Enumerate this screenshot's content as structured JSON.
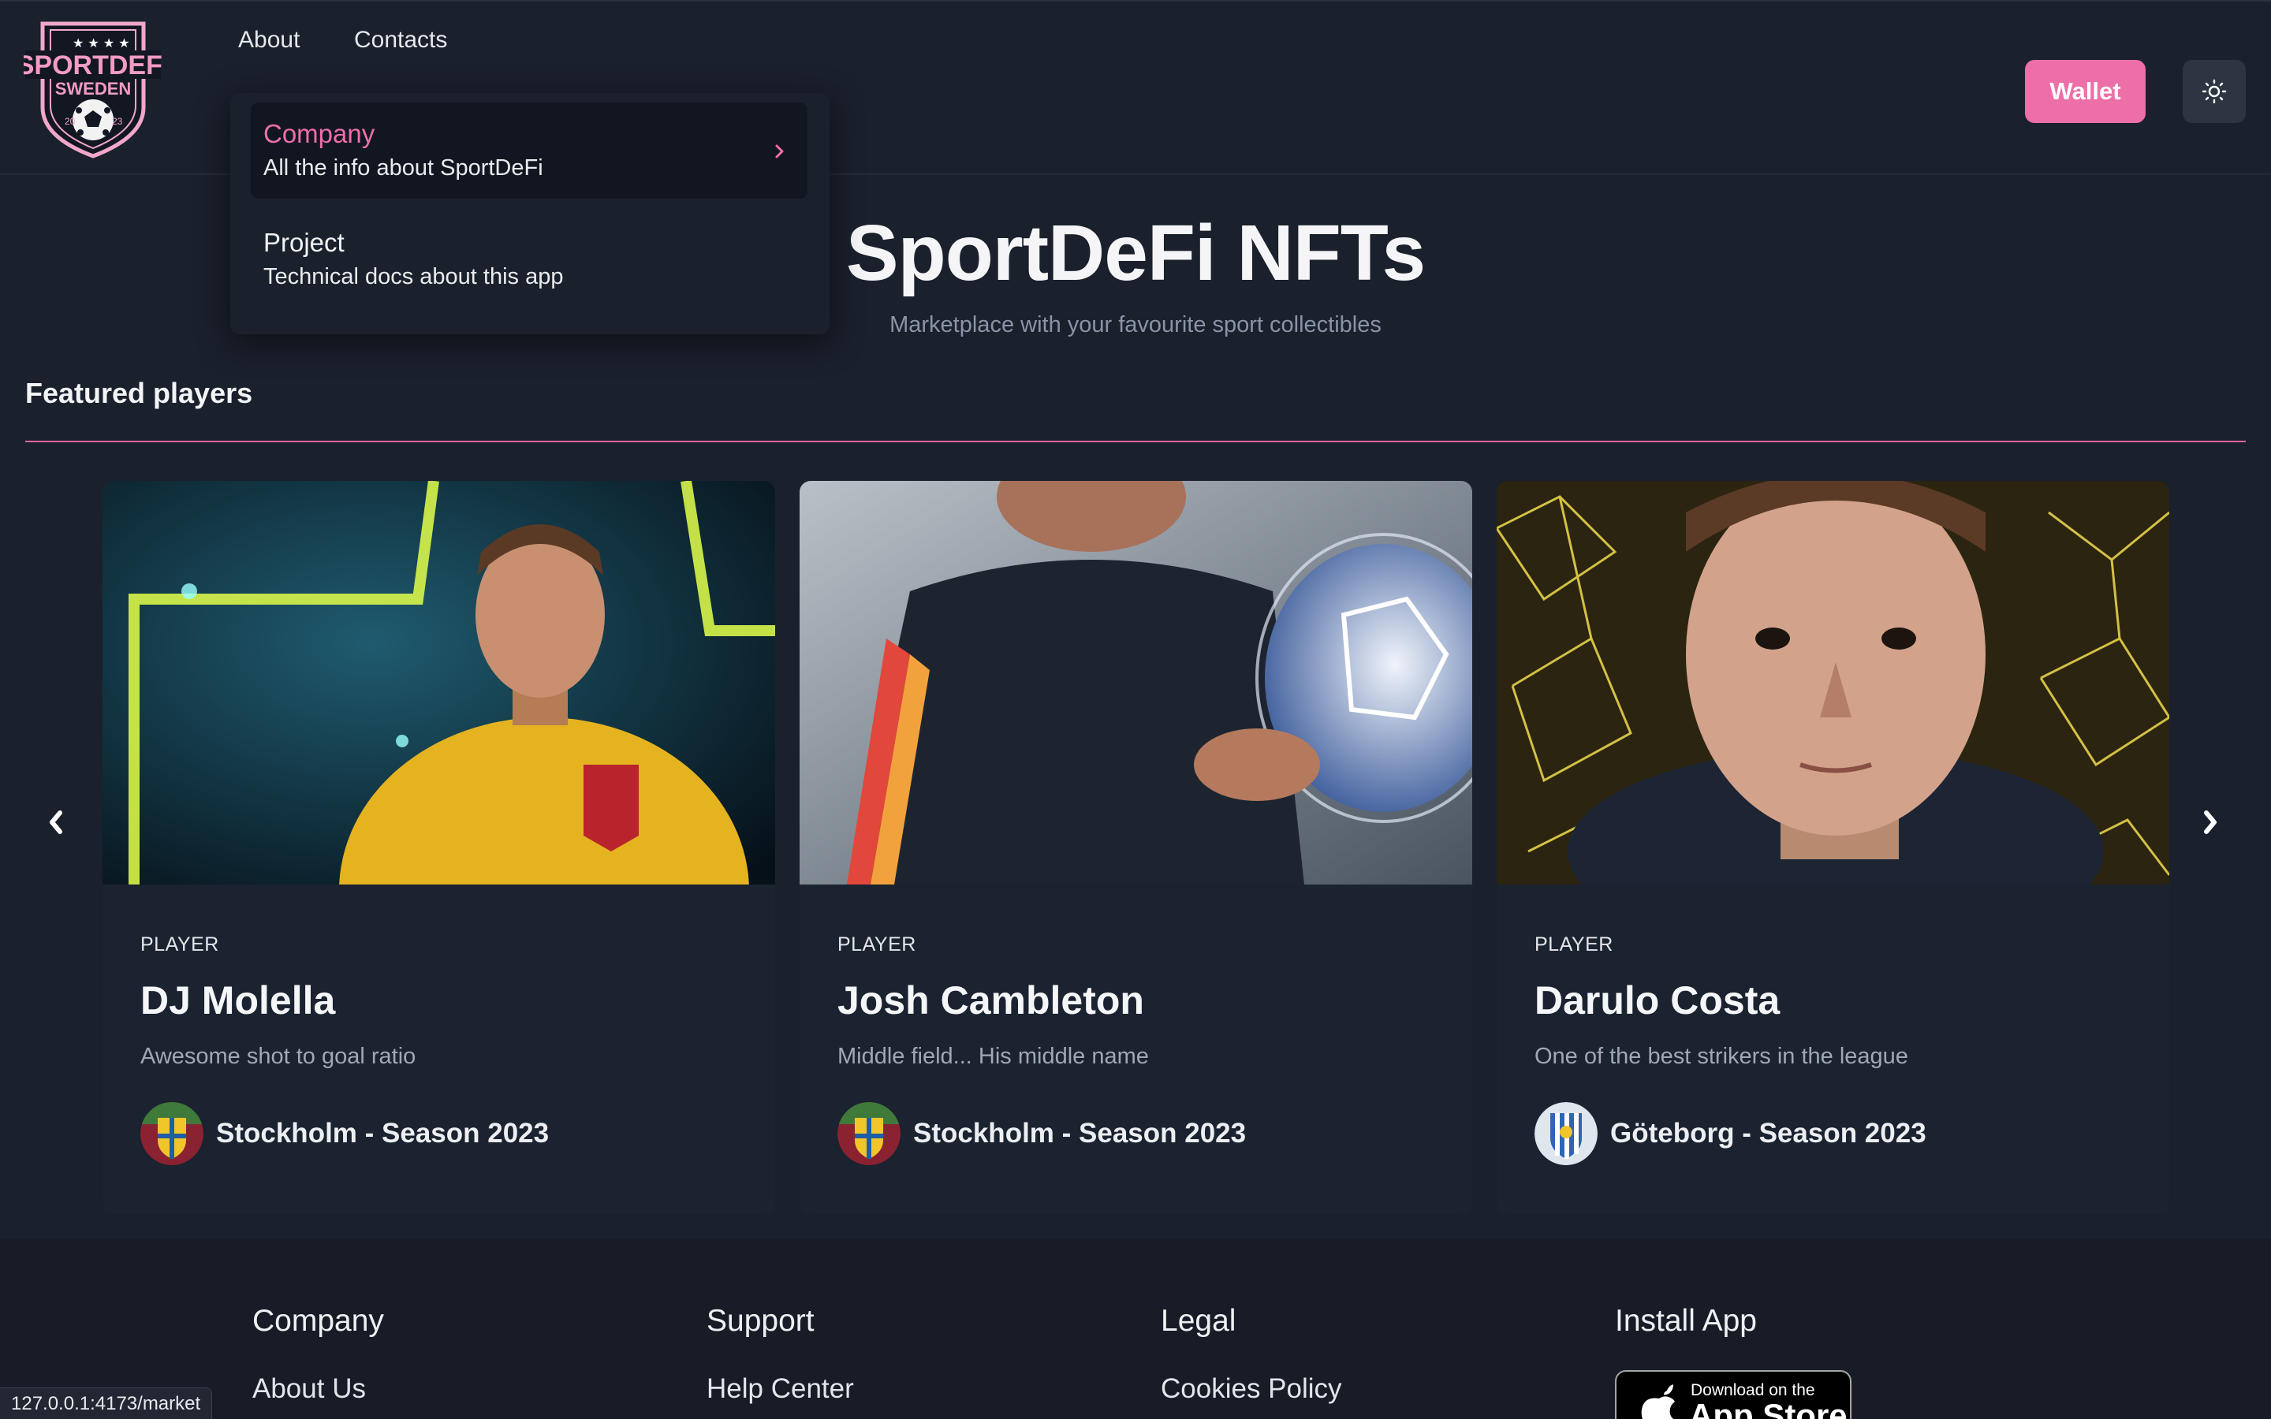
{
  "header": {
    "logo": {
      "top_text": "SPORTDEFI",
      "bottom_text": "SWEDEN",
      "year_left": "20",
      "year_right": "23"
    },
    "nav": [
      {
        "label": "About"
      },
      {
        "label": "Contacts"
      }
    ],
    "wallet_label": "Wallet",
    "theme_icon": "sun-icon"
  },
  "dropdown": {
    "items": [
      {
        "title": "Company",
        "subtitle": "All the info about SportDeFi",
        "active": true
      },
      {
        "title": "Project",
        "subtitle": "Technical docs about this app",
        "active": false
      }
    ]
  },
  "hero": {
    "title": "SportDeFi NFTs",
    "subtitle": "Marketplace with your favourite sport collectibles"
  },
  "featured": {
    "title": "Featured players",
    "prev_icon": "chevron-left-icon",
    "next_icon": "chevron-right-icon",
    "cards": [
      {
        "kicker": "PLAYER",
        "name": "DJ Molella",
        "description": "Awesome shot to goal ratio",
        "team": "Stockholm - Season 2023"
      },
      {
        "kicker": "PLAYER",
        "name": "Josh Cambleton",
        "description": "Middle field... His middle name",
        "team": "Stockholm - Season 2023"
      },
      {
        "kicker": "PLAYER",
        "name": "Darulo Costa",
        "description": "One of the best strikers in the league",
        "team": "Göteborg - Season 2023"
      }
    ]
  },
  "footer": {
    "columns": [
      {
        "heading": "Company",
        "first_link": "About Us"
      },
      {
        "heading": "Support",
        "first_link": "Help Center"
      },
      {
        "heading": "Legal",
        "first_link": "Cookies Policy"
      },
      {
        "heading": "Install App"
      }
    ],
    "appstore": {
      "small": "Download on the",
      "big": "App Store"
    }
  },
  "status_bar": {
    "url": "127.0.0.1:4173/market"
  },
  "colors": {
    "accent": "#ec6fa8",
    "background": "#1a202c",
    "card": "#1b2230"
  }
}
